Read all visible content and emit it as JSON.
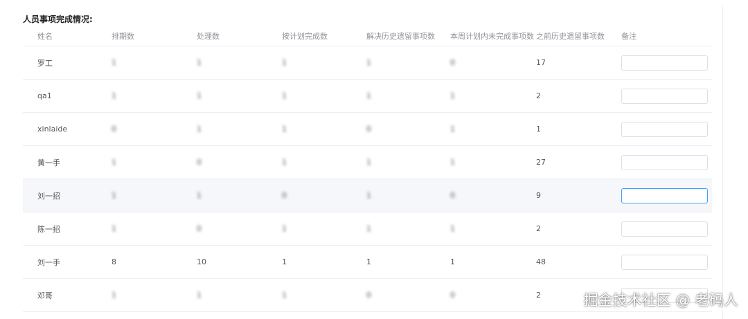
{
  "section": {
    "title": "人员事项完成情况:"
  },
  "table": {
    "columns": [
      "姓名",
      "排期数",
      "处理数",
      "按计划完成数",
      "解决历史遗留事项数",
      "本周计划内未完成事项数",
      "之前历史遗留事项数",
      "备注"
    ],
    "rows": [
      {
        "name": "罗工",
        "scheduled": "1",
        "handled": "1",
        "planned_done": "1",
        "legacy_solved": "1",
        "unfinished": "0",
        "previous_legacy": "17",
        "remark": ""
      },
      {
        "name": "qa1",
        "scheduled": "1",
        "handled": "1",
        "planned_done": "1",
        "legacy_solved": "1",
        "unfinished": "1",
        "previous_legacy": "2",
        "remark": ""
      },
      {
        "name": "xinlaide",
        "scheduled": "0",
        "handled": "1",
        "planned_done": "1",
        "legacy_solved": "0",
        "unfinished": "1",
        "previous_legacy": "1",
        "remark": ""
      },
      {
        "name": "黄一手",
        "scheduled": "1",
        "handled": "0",
        "planned_done": "1",
        "legacy_solved": "1",
        "unfinished": "1",
        "previous_legacy": "27",
        "remark": ""
      },
      {
        "name": "刘一招",
        "scheduled": "1",
        "handled": "1",
        "planned_done": "0",
        "legacy_solved": "1",
        "unfinished": "0",
        "previous_legacy": "9",
        "remark": ""
      },
      {
        "name": "陈一招",
        "scheduled": "1",
        "handled": "0",
        "planned_done": "1",
        "legacy_solved": "1",
        "unfinished": "1",
        "previous_legacy": "2",
        "remark": ""
      },
      {
        "name": "刘一手",
        "scheduled": "8",
        "handled": "10",
        "planned_done": "1",
        "legacy_solved": "1",
        "unfinished": "1",
        "previous_legacy": "48",
        "remark": ""
      },
      {
        "name": "邓哥",
        "scheduled": "1",
        "handled": "1",
        "planned_done": "1",
        "legacy_solved": "0",
        "unfinished": "0",
        "previous_legacy": "2",
        "remark": ""
      }
    ],
    "blurred_columns": [
      "scheduled",
      "handled",
      "planned_done",
      "legacy_solved",
      "unfinished"
    ],
    "clear_rows": [
      "刘一手"
    ],
    "highlighted_row": "刘一招",
    "focused_remark_row": "刘一招"
  },
  "watermark": {
    "text": "掘金技术社区 @ 老码人"
  },
  "colors": {
    "focus": "#409eff",
    "row_highlight": "#f5f7fa",
    "border": "#ebeef5"
  }
}
